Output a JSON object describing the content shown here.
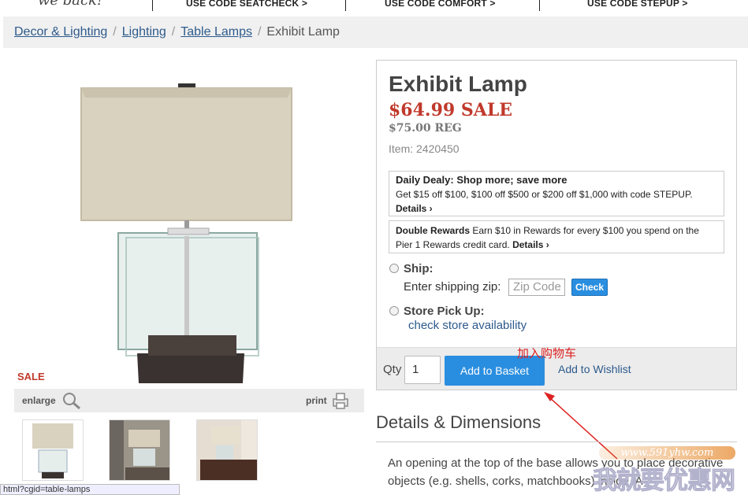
{
  "promo": {
    "script_text": "we back!",
    "codes": [
      "USE CODE SEATCHECK >",
      "USE CODE COMFORT >",
      "USE CODE STEPUP >"
    ]
  },
  "breadcrumb": {
    "links": [
      "Decor & Lighting",
      "Lighting",
      "Table Lamps"
    ],
    "current": "Exhibit Lamp",
    "separator": "/"
  },
  "gallery": {
    "sale_label": "SALE",
    "enlarge_label": "enlarge",
    "print_label": "print"
  },
  "status_url": "html?cgid=table-lamps",
  "product": {
    "title": "Exhibit Lamp",
    "sale_price": "$64.99 SALE",
    "reg_price": "$75.00 REG",
    "item_number": "Item: 2420450",
    "daily_deal_title": "Daily Dealy: Shop more; save more",
    "daily_deal_body": "Get $15 off $100, $100 off $500 or $200 off $1,000 with code STEPUP.",
    "daily_deal_link": "Details ›",
    "rewards_title": "Double Rewards",
    "rewards_body": " Earn $10 in Rewards for every $100 you spend on the Pier 1 Rewards credit card. ",
    "rewards_link": "Details ›",
    "ship_label": "Ship:",
    "zip_label": "Enter shipping zip:",
    "zip_placeholder": "Zip Code",
    "check_label": "Check",
    "pickup_label": "Store Pick Up:",
    "store_link": "check store availability",
    "qty_label": "Qty",
    "qty_value": "1",
    "add_to_basket": "Add to Basket",
    "add_to_wishlist": "Add to Wishlist"
  },
  "annotation": "加入购物车",
  "details": {
    "title": "Details & Dimensions",
    "text": "An opening at the top of the base allows you to place decorative objects (e.g. shells, corks, matchbooks) inside. A"
  },
  "watermark": {
    "url": "www.591yhw.com",
    "text": "我就要优惠网"
  },
  "colors": {
    "link": "#2d5a8c",
    "sale": "#c0392b",
    "button": "#2a8ee0",
    "annotation": "#dd2222"
  }
}
